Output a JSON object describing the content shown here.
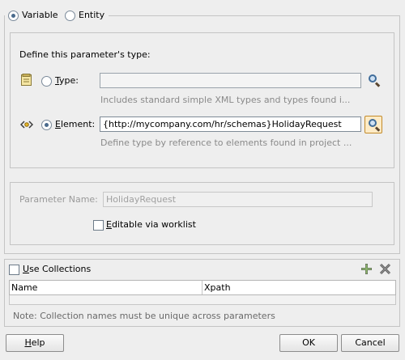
{
  "radio_group": {
    "variable_label": "Variable",
    "entity_label": "Entity",
    "selected": "Variable"
  },
  "type_section": {
    "heading": "Define this parameter's type:",
    "type_option": {
      "label_prefix": "",
      "mnemonic": "T",
      "label_rest": "ype:",
      "value": "",
      "hint": "Includes standard simple XML types and types found i...",
      "icon": "type-icon"
    },
    "element_option": {
      "mnemonic": "E",
      "label_rest": "lement:",
      "value": "{http://mycompany.com/hr/schemas}HolidayRequest",
      "hint": "Define type by reference to elements found in project ...",
      "icon": "element-icon"
    }
  },
  "parameter": {
    "name_label": "Parameter Name:",
    "name_value": "HolidayRequest",
    "editable_checkbox": {
      "mnemonic": "E",
      "label_rest": "ditable via worklist",
      "checked": false
    }
  },
  "collections": {
    "checkbox": {
      "mnemonic": "U",
      "label_rest": "se Collections",
      "checked": false
    },
    "columns": [
      "Name",
      "Xpath"
    ],
    "note": "Note: Collection names must be unique across parameters"
  },
  "buttons": {
    "help": {
      "mnemonic": "H",
      "label_rest": "elp"
    },
    "ok": "OK",
    "cancel": "Cancel"
  },
  "colors": {
    "background": "#eeeeee",
    "hint_text": "#8a8a8a",
    "active_search_border": "#c28a2a",
    "add_icon": "#4f8f2f",
    "delete_icon": "#707070"
  }
}
